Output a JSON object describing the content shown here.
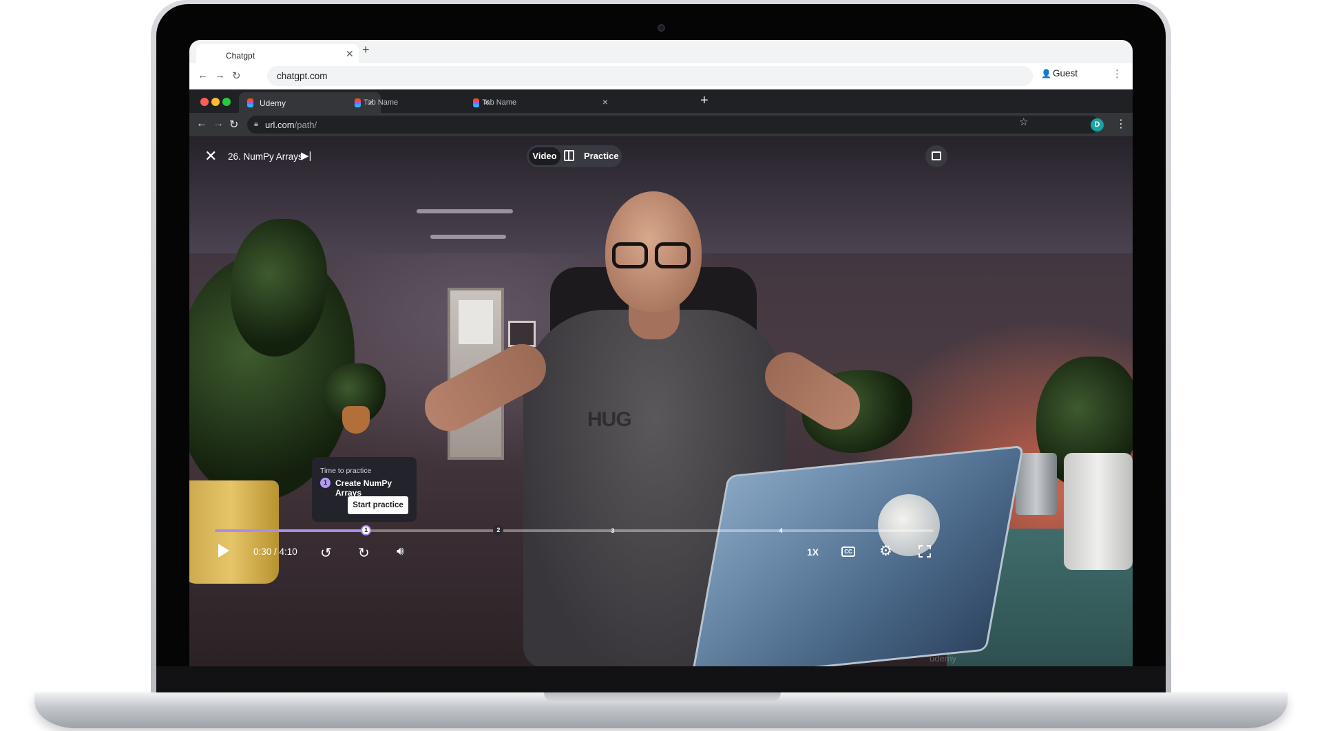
{
  "outer_browser": {
    "tab_title": "Chatgpt",
    "new_tab_label": "+",
    "address": "chatgpt.com",
    "profile_label": "Guest"
  },
  "inner_browser": {
    "tabs": [
      {
        "label": "Udemy",
        "active": true
      },
      {
        "label": "Tab Name",
        "active": false
      },
      {
        "label": "Tab Name",
        "active": false
      }
    ],
    "address_host": "url.com",
    "address_path": "/path/",
    "profile_initial": "D",
    "traffic_colors": [
      "#ff5f57",
      "#febc2e",
      "#28c840"
    ]
  },
  "player": {
    "lecture_title": "26. NumPy Arrays",
    "mode_video": "Video",
    "mode_practice": "Practice",
    "practice_popup": {
      "label": "Time to practice",
      "number": "1",
      "title": "Create NumPy Arrays",
      "button": "Start practice"
    },
    "progress_fraction": 0.21,
    "chapters": [
      {
        "number": "1",
        "position_fraction": 0.21
      },
      {
        "number": "2",
        "position_fraction": 0.394
      },
      {
        "number": "3",
        "position_fraction": 0.553
      },
      {
        "number": "4",
        "position_fraction": 0.787
      }
    ],
    "time": "0:30 / 4:10",
    "speed": "1X",
    "cc_label": "CC",
    "watermark": "udemy",
    "shirt_text": "HUG",
    "accent_color": "#a88df0"
  }
}
